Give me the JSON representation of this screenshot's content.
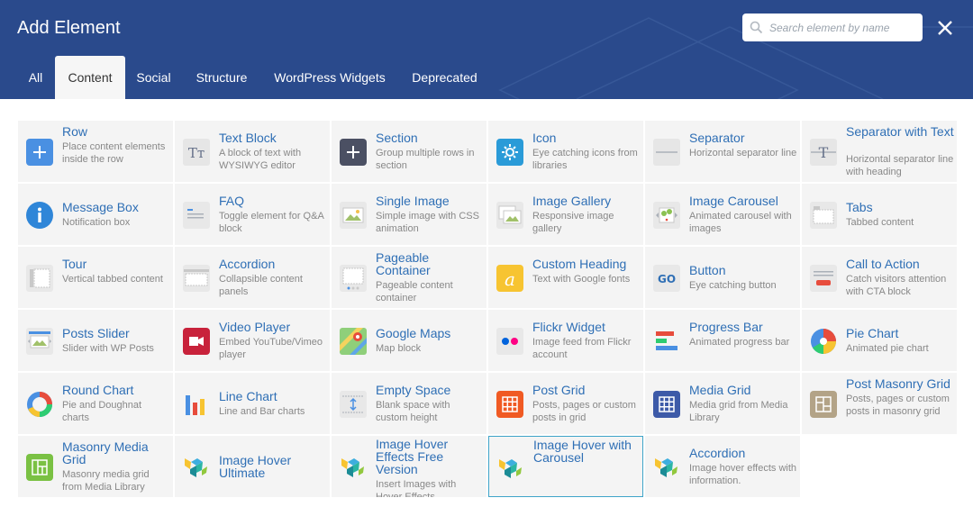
{
  "dialog": {
    "title": "Add Element",
    "search_placeholder": "Search element by name"
  },
  "tabs": [
    "All",
    "Content",
    "Social",
    "Structure",
    "WordPress Widgets",
    "Deprecated"
  ],
  "colors": {
    "header": "#2a4a8c",
    "link": "#2f6fb5",
    "cell_bg": "#f4f4f4"
  },
  "elements": [
    {
      "name": "Row",
      "desc": "Place content elements inside the row",
      "icon": "plus-blue-icon"
    },
    {
      "name": "Text Block",
      "desc": "A block of text with WYSIWYG editor",
      "icon": "text-block-icon"
    },
    {
      "name": "Section",
      "desc": "Group multiple rows in section",
      "icon": "plus-dark-icon"
    },
    {
      "name": "Icon",
      "desc": "Eye catching icons from libraries",
      "icon": "icon-element-icon"
    },
    {
      "name": "Separator",
      "desc": "Horizontal separator line",
      "icon": "separator-icon"
    },
    {
      "name": "Separator with Text",
      "desc": "Horizontal separator line with heading",
      "icon": "separator-text-icon"
    },
    {
      "name": "Message Box",
      "desc": "Notification box",
      "icon": "info-icon"
    },
    {
      "name": "FAQ",
      "desc": "Toggle element for Q&A block",
      "icon": "faq-icon"
    },
    {
      "name": "Single Image",
      "desc": "Simple image with CSS animation",
      "icon": "image-icon"
    },
    {
      "name": "Image Gallery",
      "desc": "Responsive image gallery",
      "icon": "gallery-icon"
    },
    {
      "name": "Image Carousel",
      "desc": "Animated carousel with images",
      "icon": "carousel-icon"
    },
    {
      "name": "Tabs",
      "desc": "Tabbed content",
      "icon": "tabs-icon"
    },
    {
      "name": "Tour",
      "desc": "Vertical tabbed content",
      "icon": "tour-icon"
    },
    {
      "name": "Accordion",
      "desc": "Collapsible content panels",
      "icon": "accordion-icon"
    },
    {
      "name": "Pageable Container",
      "desc": "Pageable content container",
      "icon": "pageable-icon"
    },
    {
      "name": "Custom Heading",
      "desc": "Text with Google fonts",
      "icon": "custom-heading-icon"
    },
    {
      "name": "Button",
      "desc": "Eye catching button",
      "icon": "button-icon"
    },
    {
      "name": "Call to Action",
      "desc": "Catch visitors attention with CTA block",
      "icon": "cta-icon"
    },
    {
      "name": "Posts Slider",
      "desc": "Slider with WP Posts",
      "icon": "posts-slider-icon"
    },
    {
      "name": "Video Player",
      "desc": "Embed YouTube/Vimeo player",
      "icon": "video-icon"
    },
    {
      "name": "Google Maps",
      "desc": "Map block",
      "icon": "map-icon"
    },
    {
      "name": "Flickr Widget",
      "desc": "Image feed from Flickr account",
      "icon": "flickr-icon"
    },
    {
      "name": "Progress Bar",
      "desc": "Animated progress bar",
      "icon": "progress-bar-icon"
    },
    {
      "name": "Pie Chart",
      "desc": "Animated pie chart",
      "icon": "pie-chart-icon"
    },
    {
      "name": "Round Chart",
      "desc": "Pie and Doughnat charts",
      "icon": "round-chart-icon"
    },
    {
      "name": "Line Chart",
      "desc": "Line and Bar charts",
      "icon": "line-chart-icon"
    },
    {
      "name": "Empty Space",
      "desc": "Blank space with custom height",
      "icon": "empty-space-icon"
    },
    {
      "name": "Post Grid",
      "desc": "Posts, pages or custom posts in grid",
      "icon": "post-grid-icon"
    },
    {
      "name": "Media Grid",
      "desc": "Media grid from Media Library",
      "icon": "media-grid-icon"
    },
    {
      "name": "Post Masonry Grid",
      "desc": "Posts, pages or custom posts in masonry grid",
      "icon": "post-masonry-icon"
    },
    {
      "name": "Masonry Media Grid",
      "desc": "Masonry media grid from Media Library",
      "icon": "masonry-media-icon"
    },
    {
      "name": "Image Hover Ultimate",
      "desc": "",
      "icon": "vc-logo-icon"
    },
    {
      "name": "Image Hover Effects Free Version",
      "desc": "Insert Images with Hover Effects",
      "icon": "vc-logo-icon"
    },
    {
      "name": "Image Hover with Carousel",
      "desc": "",
      "icon": "vc-logo-icon"
    },
    {
      "name": "Accordion",
      "desc": "Image hover effects with information.",
      "icon": "vc-logo-icon"
    }
  ]
}
